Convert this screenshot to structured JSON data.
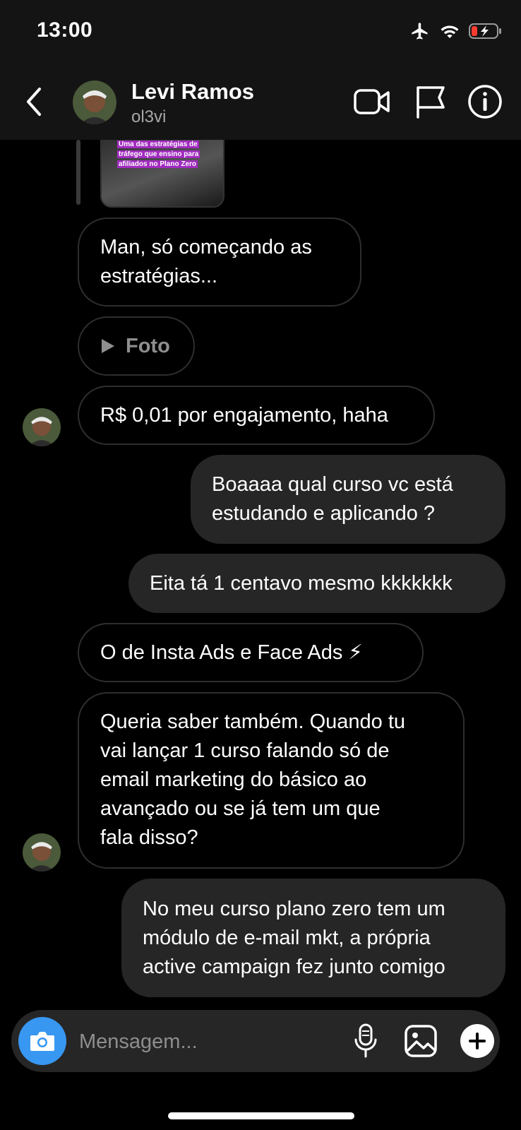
{
  "status_bar": {
    "time": "13:00",
    "icons": [
      "airplane-icon",
      "wifi-icon",
      "battery-low-charging-icon"
    ]
  },
  "header": {
    "name": "Levi Ramos",
    "handle": "ol3vi",
    "icons": [
      "back-icon",
      "video-call-icon",
      "flag-icon",
      "info-icon"
    ]
  },
  "story_reply": {
    "caption": "Uma das estratégias de tráfego que ensino para afiliados no Plano Zero"
  },
  "messages": [
    {
      "from": "them",
      "text": "Man, só começando as\nestratégias..."
    },
    {
      "from": "them",
      "type": "photo",
      "text": "Foto"
    },
    {
      "from": "them",
      "text": "R$ 0,01 por engajamento, haha"
    },
    {
      "from": "me",
      "text": "Boaaaa qual curso vc está\nestudando e aplicando ?"
    },
    {
      "from": "me",
      "text": "Eita tá 1 centavo mesmo kkkkkkk"
    },
    {
      "from": "them",
      "text": "O de Insta Ads e Face Ads ⚡"
    },
    {
      "from": "them",
      "text": "Queria saber também. Quando tu\nvai lançar 1 curso falando só de\nemail marketing do básico ao\navançado ou se já tem um que\nfala disso?"
    },
    {
      "from": "me",
      "text": "No meu curso plano zero tem um\nmódulo de e-mail mkt, a própria\nactive campaign fez junto comigo"
    }
  ],
  "composer": {
    "placeholder": "Mensagem...",
    "value": ""
  },
  "colors": {
    "background": "#000000",
    "bar": "#141414",
    "outgoing_bubble": "#262626",
    "incoming_border": "#2e2e2e",
    "camera_button": "#3897f0",
    "battery_low": "#ff3b30"
  }
}
